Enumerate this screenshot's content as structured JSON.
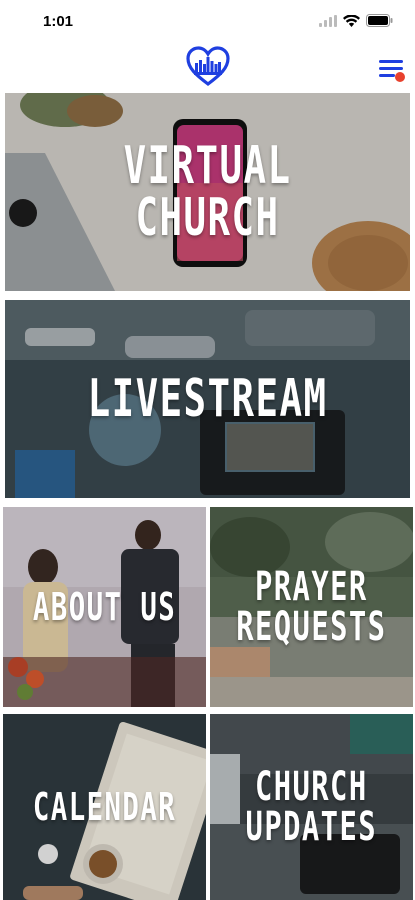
{
  "status_bar": {
    "time": "1:01"
  },
  "header": {
    "logo_icon": "heart-city-logo-icon",
    "menu_icon": "hamburger-menu-icon",
    "brand_color": "#1f3fe0",
    "notification_dot_color": "#e8412d"
  },
  "tiles": [
    {
      "label": "VIRTUAL CHURCH"
    },
    {
      "label": "LIVESTREAM"
    },
    {
      "label": "ABOUT US"
    },
    {
      "label": "PRAYER\nREQUESTS"
    },
    {
      "label": "CALENDAR"
    },
    {
      "label": "CHURCH\nUPDATES"
    }
  ]
}
